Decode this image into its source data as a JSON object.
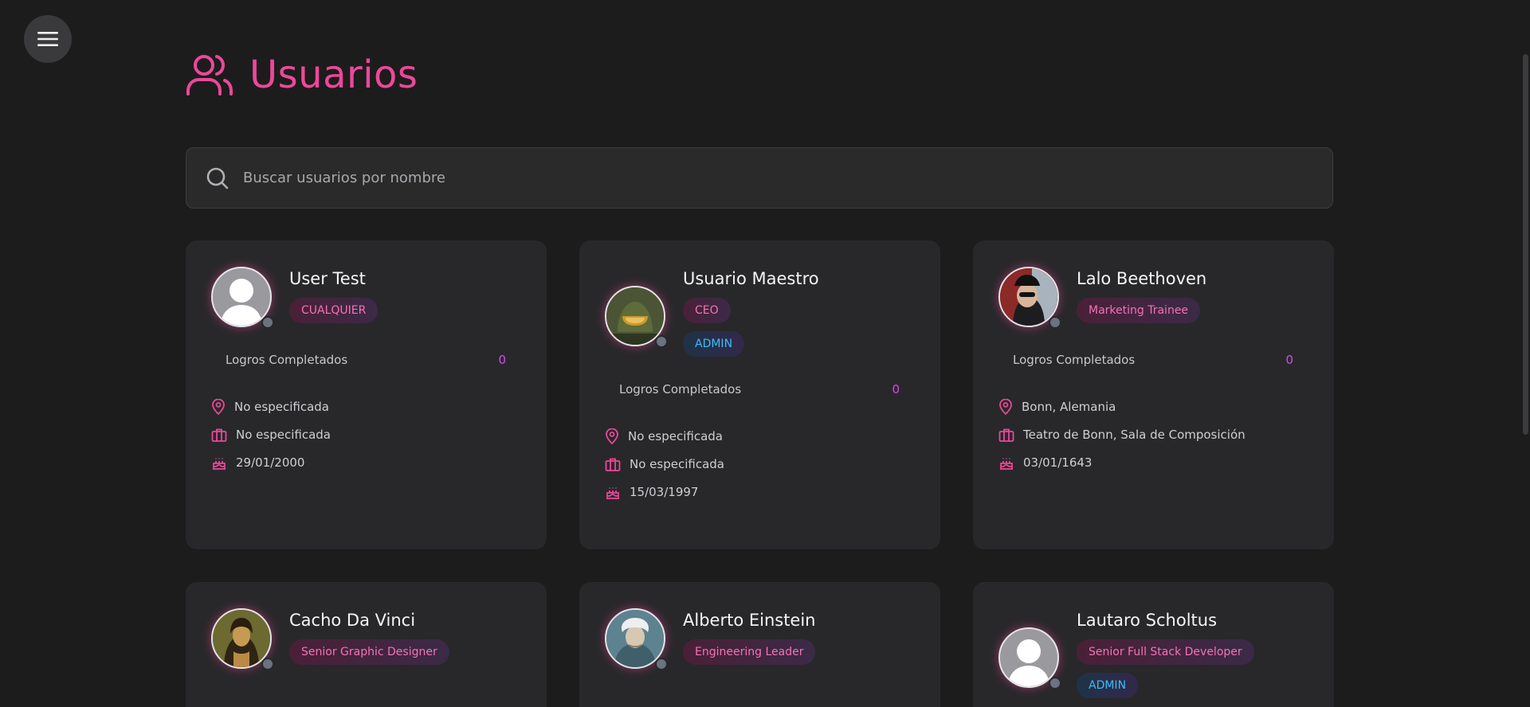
{
  "page": {
    "title": "Usuarios"
  },
  "search": {
    "placeholder": "Buscar usuarios por nombre",
    "value": ""
  },
  "stats_label": "Logros Completados",
  "colors": {
    "accent": "#ec4899",
    "admin": "#38bdf8",
    "background": "#1c1c1d",
    "card": "#28282a"
  },
  "users": [
    {
      "name": "User Test",
      "badges": [
        "CUALQUIER"
      ],
      "admin_badge": "",
      "avatar": "default-avatar",
      "stats_value": "0",
      "location": "No especificada",
      "workplace": "No especificada",
      "birthday": "29/01/2000"
    },
    {
      "name": "Usuario Maestro",
      "badges": [
        "CEO"
      ],
      "admin_badge": "ADMIN",
      "avatar": "helmet-avatar",
      "stats_value": "0",
      "location": "No especificada",
      "workplace": "No especificada",
      "birthday": "15/03/1997"
    },
    {
      "name": "Lalo Beethoven",
      "badges": [
        "Marketing Trainee"
      ],
      "admin_badge": "",
      "avatar": "photo-avatar",
      "stats_value": "0",
      "location": "Bonn, Alemania",
      "workplace": "Teatro de Bonn, Sala de Composición",
      "birthday": "03/01/1643"
    },
    {
      "name": "Cacho Da Vinci",
      "badges": [
        "Senior Graphic Designer"
      ],
      "admin_badge": "",
      "avatar": "painting-avatar"
    },
    {
      "name": "Alberto Einstein",
      "badges": [
        "Engineering Leader"
      ],
      "admin_badge": "",
      "avatar": "portrait-avatar"
    },
    {
      "name": "Lautaro Scholtus",
      "badges": [
        "Senior Full Stack Developer"
      ],
      "admin_badge": "ADMIN",
      "avatar": "default-avatar"
    }
  ]
}
